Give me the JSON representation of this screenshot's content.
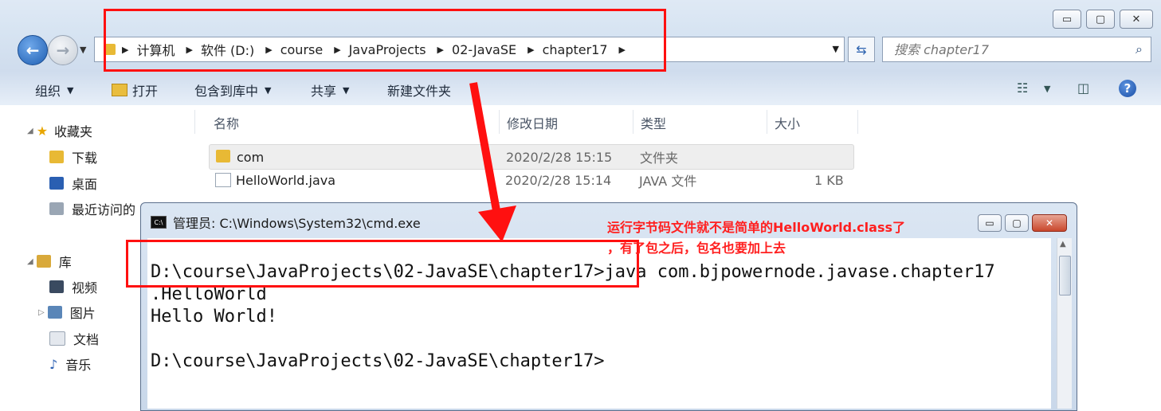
{
  "window_controls": {
    "minimize": "▭",
    "maximize": "▢",
    "close": "✕"
  },
  "address": {
    "crumbs": [
      "计算机",
      "软件 (D:)",
      "course",
      "JavaProjects",
      "02-JavaSE",
      "chapter17"
    ],
    "search_placeholder": "搜索 chapter17"
  },
  "toolbar": {
    "organize": "组织",
    "open": "打开",
    "include_library": "包含到库中",
    "share": "共享",
    "new_folder": "新建文件夹"
  },
  "sidebar": {
    "favorites": "收藏夹",
    "downloads": "下载",
    "desktop": "桌面",
    "recent": "最近访问的",
    "libraries": "库",
    "videos": "视频",
    "pictures": "图片",
    "documents": "文档",
    "music": "音乐"
  },
  "columns": {
    "name": "名称",
    "date": "修改日期",
    "type": "类型",
    "size": "大小"
  },
  "files": [
    {
      "name": "com",
      "date": "2020/2/28 15:15",
      "type": "文件夹",
      "size": "",
      "icon": "folder-icon"
    },
    {
      "name": "HelloWorld.java",
      "date": "2020/2/28 15:14",
      "type": "JAVA 文件",
      "size": "1 KB",
      "icon": "document-icon"
    }
  ],
  "cmd": {
    "title": "管理员: C:\\Windows\\System32\\cmd.exe",
    "icon_text": "C:\\",
    "lines": [
      "D:\\course\\JavaProjects\\02-JavaSE\\chapter17>java com.bjpowernode.javase.chapter17",
      ".HelloWorld",
      "Hello World!",
      "",
      "D:\\course\\JavaProjects\\02-JavaSE\\chapter17>"
    ]
  },
  "annotation": {
    "line1": "运行字节码文件就不是简单的HelloWorld.class了",
    "line2": "，有了包之后，包名也要加上去",
    "color": "#ff1010"
  }
}
